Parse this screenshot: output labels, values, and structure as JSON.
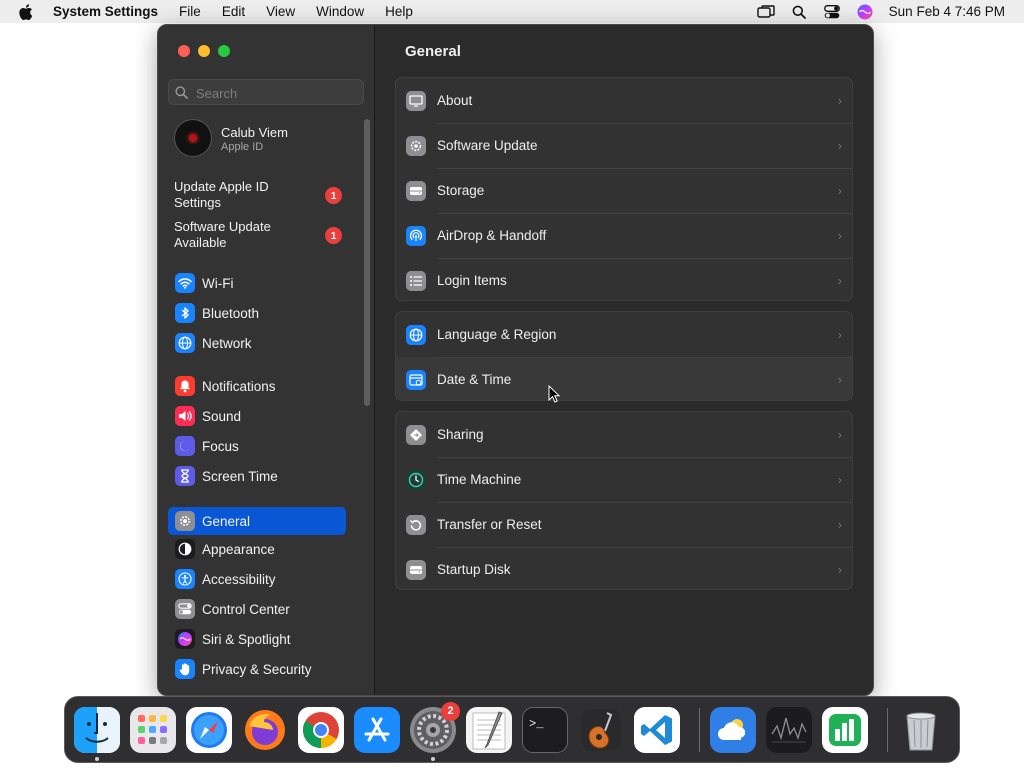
{
  "menubar": {
    "app_name": "System Settings",
    "menus": [
      "File",
      "Edit",
      "View",
      "Window",
      "Help"
    ],
    "clock": "Sun Feb 4  7:46 PM"
  },
  "sidebar": {
    "search_placeholder": "Search",
    "account": {
      "name": "Calub Viem",
      "subtitle": "Apple ID"
    },
    "notices": [
      {
        "label": "Update Apple ID Settings",
        "badge": "1"
      },
      {
        "label": "Software Update Available",
        "badge": "1"
      }
    ],
    "items": [
      {
        "label": "Wi-Fi",
        "icon": "wifi-icon",
        "color": "#1a84ff"
      },
      {
        "label": "Bluetooth",
        "icon": "bluetooth-icon",
        "color": "#1a84ff"
      },
      {
        "label": "Network",
        "icon": "globe-icon",
        "color": "#1a84ff"
      },
      {
        "label": "Notifications",
        "icon": "bell-icon",
        "color": "#ff3b30"
      },
      {
        "label": "Sound",
        "icon": "speaker-icon",
        "color": "#ff2d55"
      },
      {
        "label": "Focus",
        "icon": "moon-icon",
        "color": "#5e5ce6"
      },
      {
        "label": "Screen Time",
        "icon": "hourglass-icon",
        "color": "#5e5ce6"
      },
      {
        "label": "General",
        "icon": "gear-icon",
        "color": "#8e8e93",
        "active": true
      },
      {
        "label": "Appearance",
        "icon": "appearance-icon",
        "color": "#1c1c1e"
      },
      {
        "label": "Accessibility",
        "icon": "accessibility-icon",
        "color": "#1a84ff"
      },
      {
        "label": "Control Center",
        "icon": "control-center-icon",
        "color": "#8e8e93"
      },
      {
        "label": "Siri & Spotlight",
        "icon": "siri-icon",
        "color": "#1c1c1e"
      },
      {
        "label": "Privacy & Security",
        "icon": "hand-icon",
        "color": "#1a84ff"
      }
    ]
  },
  "main": {
    "title": "General",
    "groups": [
      {
        "rows": [
          {
            "label": "About",
            "icon": "display-icon"
          },
          {
            "label": "Software Update",
            "icon": "gear-badge-icon"
          },
          {
            "label": "Storage",
            "icon": "drive-icon"
          },
          {
            "label": "AirDrop & Handoff",
            "icon": "airdrop-icon"
          },
          {
            "label": "Login Items",
            "icon": "list-icon"
          }
        ]
      },
      {
        "rows": [
          {
            "label": "Language & Region",
            "icon": "globe-icon"
          },
          {
            "label": "Date & Time",
            "icon": "calendar-clock-icon"
          }
        ]
      },
      {
        "rows": [
          {
            "label": "Sharing",
            "icon": "sharing-icon"
          },
          {
            "label": "Time Machine",
            "icon": "time-machine-icon"
          },
          {
            "label": "Transfer or Reset",
            "icon": "reset-icon"
          },
          {
            "label": "Startup Disk",
            "icon": "disk-icon"
          }
        ]
      }
    ]
  },
  "dock": {
    "apps": [
      {
        "name": "Finder",
        "icon": "finder-icon",
        "running": true
      },
      {
        "name": "Launchpad",
        "icon": "launchpad-icon"
      },
      {
        "name": "Safari",
        "icon": "safari-icon"
      },
      {
        "name": "Firefox",
        "icon": "firefox-icon"
      },
      {
        "name": "Chrome",
        "icon": "chrome-icon"
      },
      {
        "name": "App Store",
        "icon": "app-store-icon"
      },
      {
        "name": "System Settings",
        "icon": "system-settings-icon",
        "badge": "2",
        "running": true
      },
      {
        "name": "TextEdit",
        "icon": "textedit-icon"
      },
      {
        "name": "Terminal",
        "icon": "terminal-icon"
      },
      {
        "name": "GarageBand",
        "icon": "garageband-icon"
      },
      {
        "name": "Visual Studio Code",
        "icon": "vscode-icon"
      },
      {
        "name": "Weather",
        "icon": "weather-icon"
      },
      {
        "name": "Stocks",
        "icon": "stocks-icon"
      },
      {
        "name": "Numbers",
        "icon": "numbers-icon"
      },
      {
        "name": "Trash",
        "icon": "trash-icon"
      }
    ]
  }
}
